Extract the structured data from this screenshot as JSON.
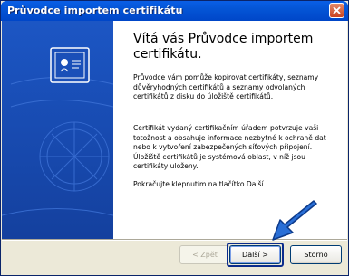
{
  "window": {
    "title": "Průvodce importem certifikátu"
  },
  "main": {
    "heading": "Vítá vás Průvodce importem certifikátu.",
    "paragraphs": [
      "Průvodce vám pomůže kopírovat certifikáty, seznamy důvěryhodných certifikátů a seznamy odvolaných certifikátů z disku do úložiště certifikátů.",
      "Certifikát vydaný certifikačním úřadem potvrzuje vaši totožnost a obsahuje informace nezbytné k ochraně dat nebo k vytvoření zabezpečených síťových připojení. Úložiště certifikátů je systémová oblast, v níž jsou certifikáty uloženy.",
      "Pokračujte klepnutím na tlačítko Další."
    ]
  },
  "buttons": {
    "back": "< Zpět",
    "next": "Další >",
    "cancel": "Storno"
  },
  "icons": {
    "close": "close-icon",
    "certificate": "certificate-icon",
    "annotation_arrow": "arrow-annotation"
  },
  "colors": {
    "title_bar": "#0455d6",
    "sidebar": "#1c56c4",
    "arrow": "#2a6fd6"
  }
}
